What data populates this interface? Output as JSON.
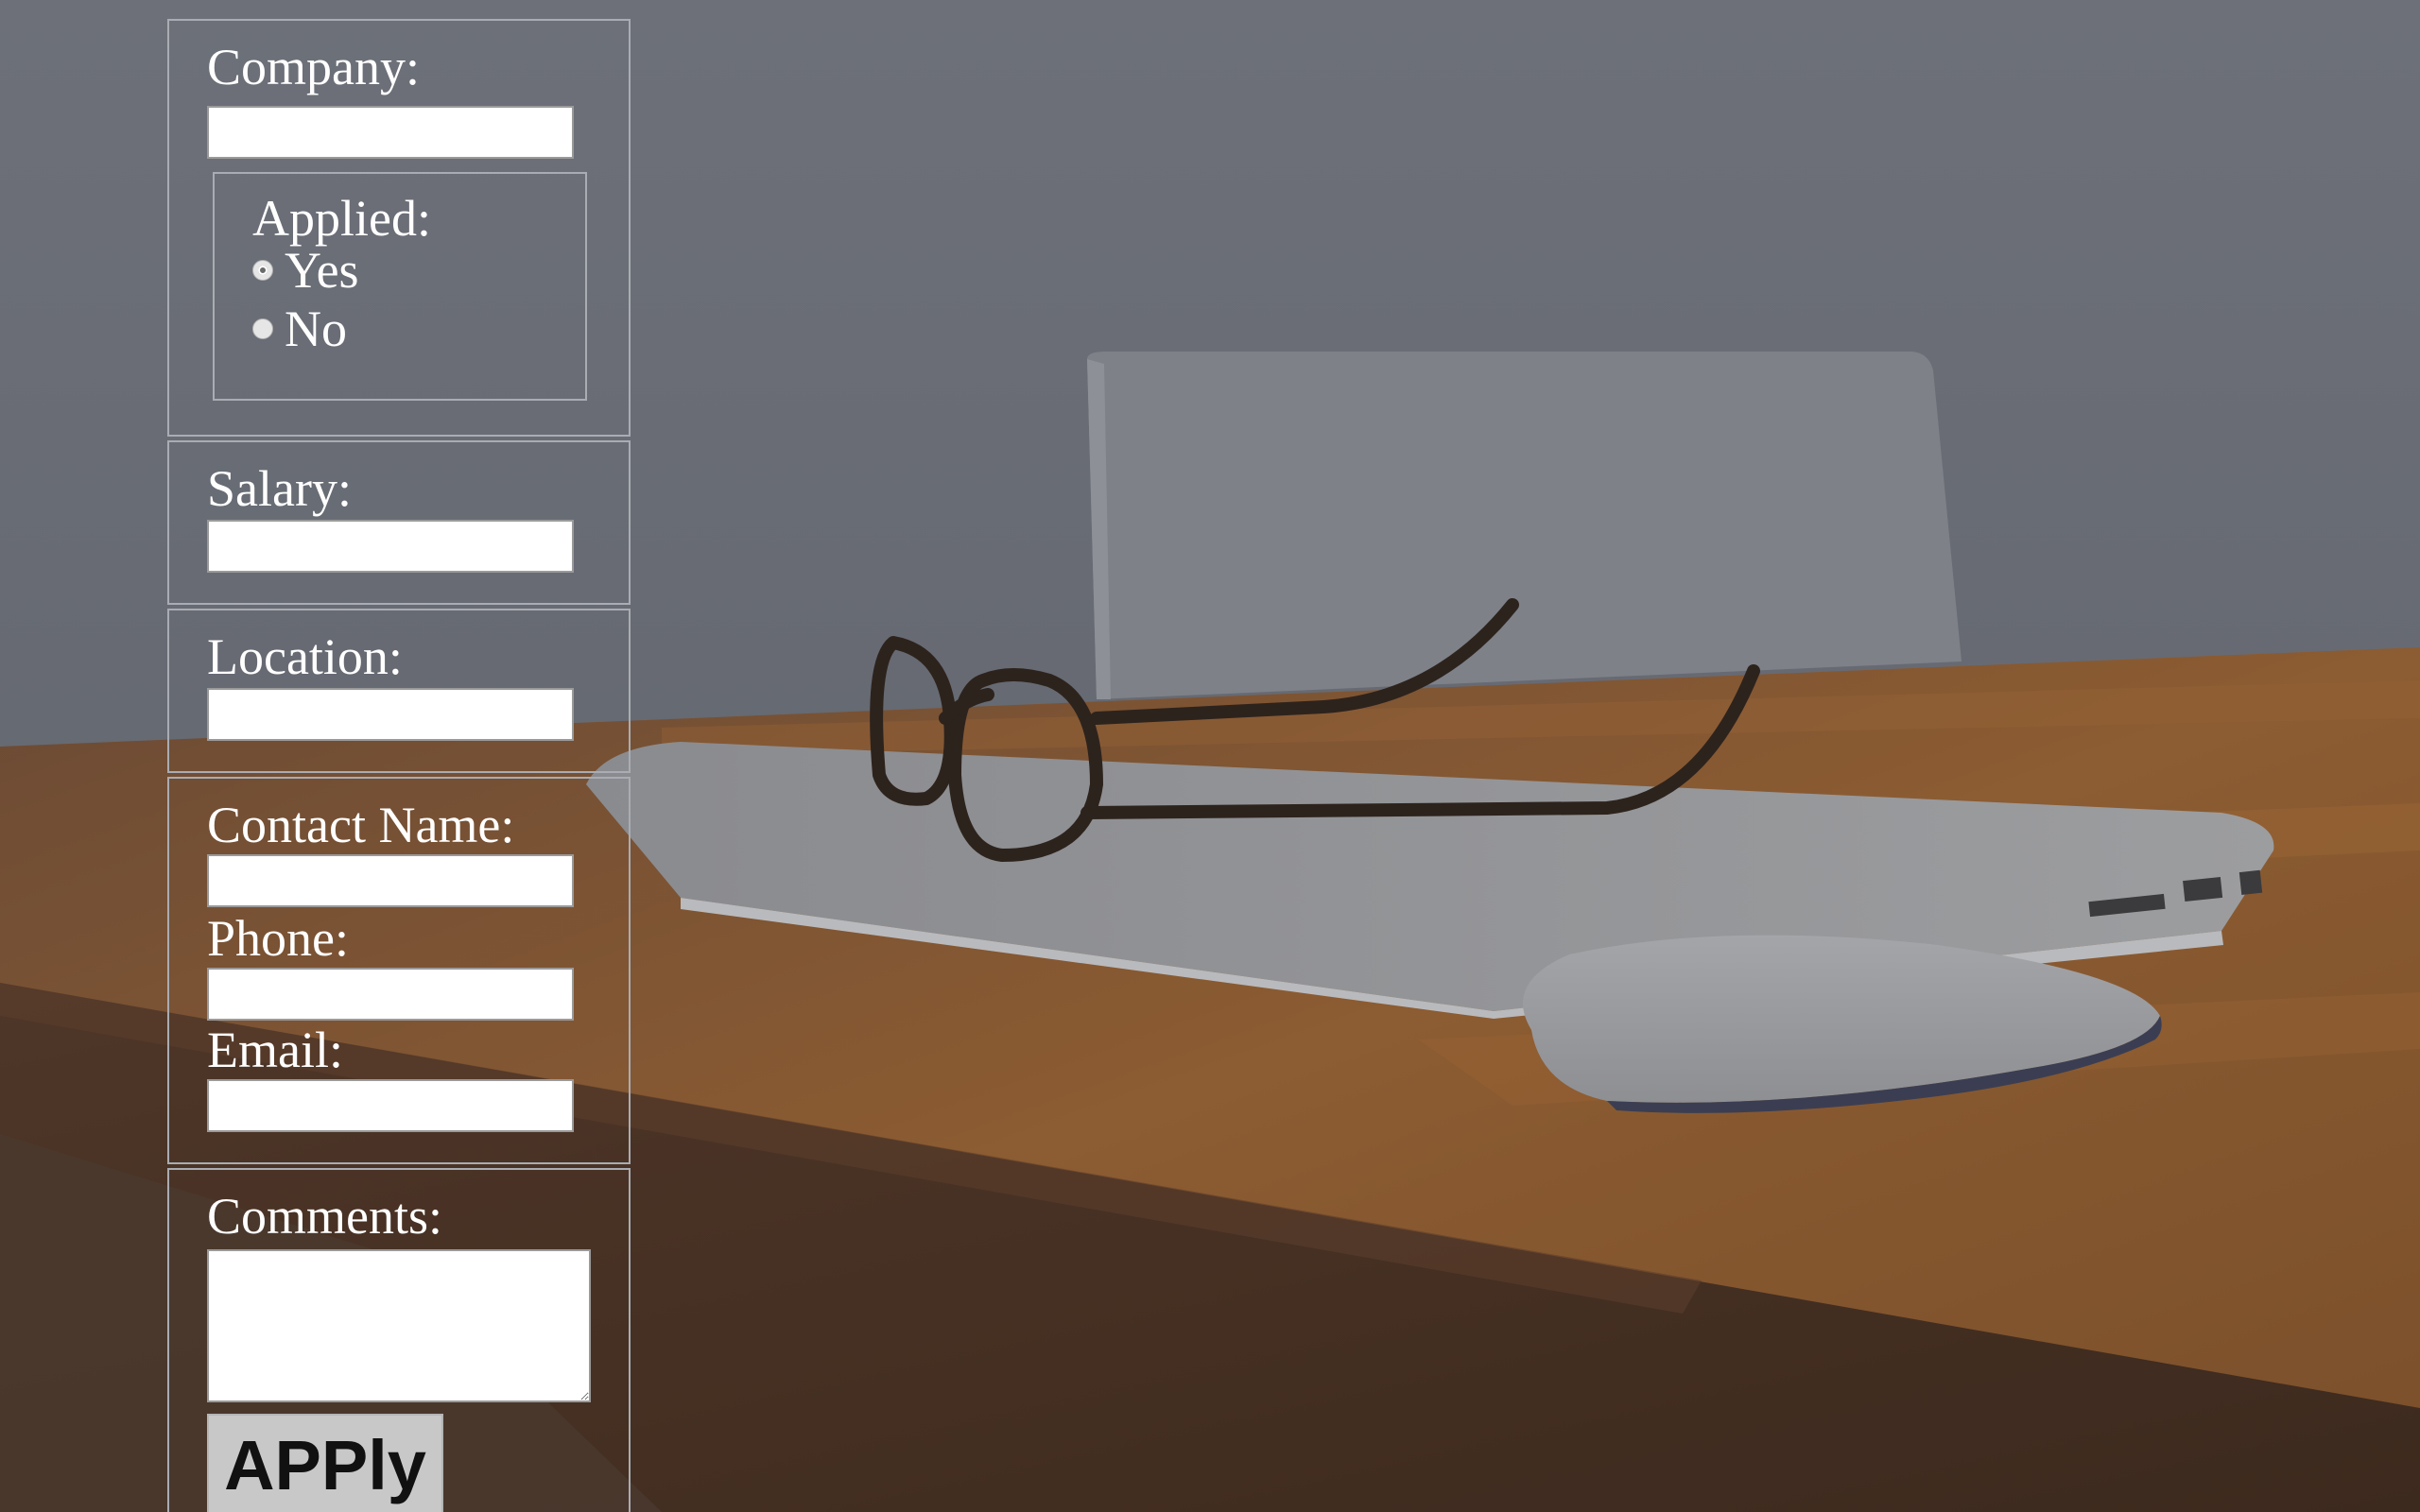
{
  "form": {
    "company": {
      "label": "Company:",
      "value": ""
    },
    "applied": {
      "legend": "Applied:",
      "options": [
        {
          "label": "Yes",
          "checked": true
        },
        {
          "label": "No",
          "checked": false
        }
      ]
    },
    "salary": {
      "label": "Salary:",
      "value": ""
    },
    "location": {
      "label": "Location:",
      "value": ""
    },
    "contact": {
      "name_label": "Contact Name:",
      "name_value": "",
      "phone_label": "Phone:",
      "phone_value": "",
      "email_label": "Email:",
      "email_value": ""
    },
    "comments": {
      "label": "Comments:",
      "value": ""
    },
    "submit_label": "APPly"
  },
  "colors": {
    "background_overlay": "#6c6f77",
    "field_border": "#a9acb2",
    "button_bg": "#c8c8c8"
  }
}
